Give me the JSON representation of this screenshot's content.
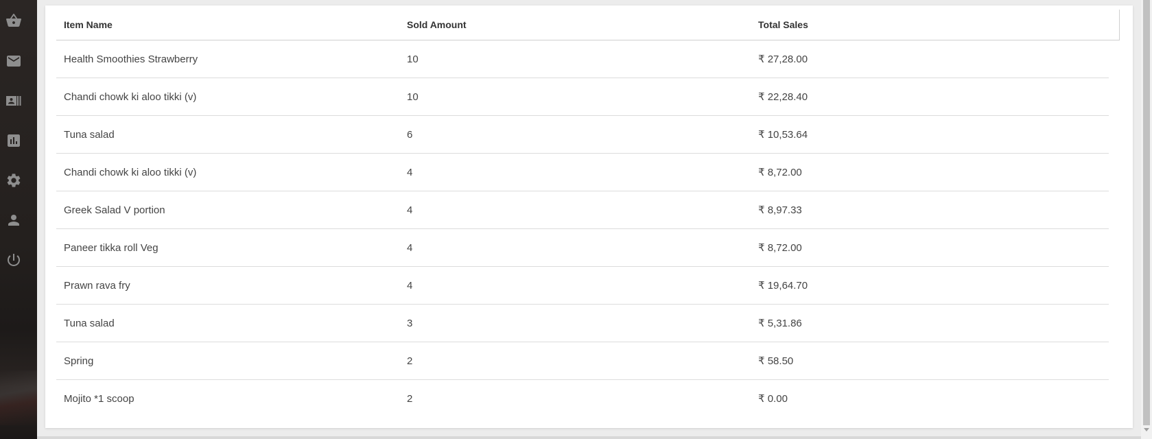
{
  "sidebar": {
    "items": [
      {
        "icon": "basket-icon"
      },
      {
        "icon": "mail-icon"
      },
      {
        "icon": "contact-card-icon"
      },
      {
        "icon": "bar-chart-icon"
      },
      {
        "icon": "gear-icon"
      },
      {
        "icon": "person-icon"
      },
      {
        "icon": "power-icon"
      }
    ]
  },
  "table": {
    "headers": {
      "item_name": "Item Name",
      "sold_amount": "Sold Amount",
      "total_sales": "Total Sales"
    },
    "rows": [
      {
        "name": "Health Smoothies Strawberry",
        "sold": "10",
        "total": "₹ 27,28.00"
      },
      {
        "name": "Chandi chowk ki aloo tikki (v)",
        "sold": "10",
        "total": "₹ 22,28.40"
      },
      {
        "name": "Tuna salad",
        "sold": "6",
        "total": "₹ 10,53.64"
      },
      {
        "name": "Chandi chowk ki aloo tikki (v)",
        "sold": "4",
        "total": "₹ 8,72.00"
      },
      {
        "name": "Greek Salad V portion",
        "sold": "4",
        "total": "₹ 8,97.33"
      },
      {
        "name": "Paneer tikka roll Veg",
        "sold": "4",
        "total": "₹ 8,72.00"
      },
      {
        "name": "Prawn rava fry",
        "sold": "4",
        "total": "₹ 19,64.70"
      },
      {
        "name": "Tuna salad",
        "sold": "3",
        "total": "₹ 5,31.86"
      },
      {
        "name": "Spring",
        "sold": "2",
        "total": "₹ 58.50"
      },
      {
        "name": "Mojito *1 scoop",
        "sold": "2",
        "total": "₹ 0.00"
      }
    ]
  }
}
